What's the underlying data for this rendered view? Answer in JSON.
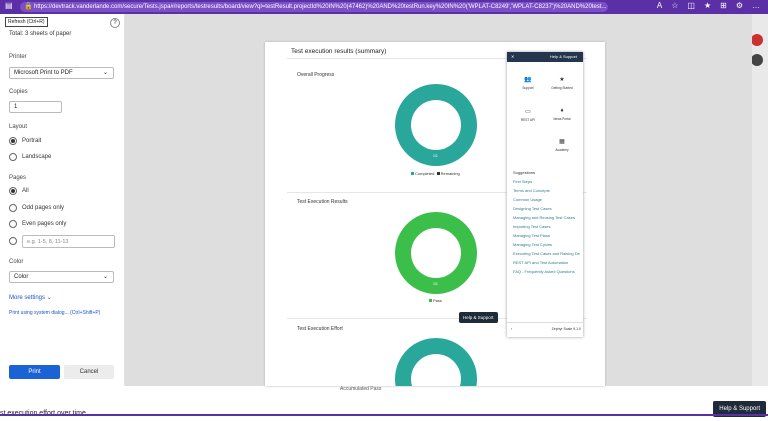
{
  "browser": {
    "url": "https://devtrack.vanderlande.com/secure/Tests.jspa#/reports/testresults/board/view?ql=testResult.projectId%20IN%20(47462)%20AND%20testRun.key%20IN%20('WPLAT-C8249','WPLAT-C8237')%20AND%20test..."
  },
  "dialog": {
    "refresh_label": "Refresh (Ctrl+R)",
    "help_icon": "?",
    "total": "Total: 3 sheets of paper",
    "printer_label": "Printer",
    "printer_value": "Microsoft Print to PDF",
    "copies_label": "Copies",
    "copies_value": "1",
    "layout_label": "Layout",
    "layout_portrait": "Portrait",
    "layout_landscape": "Landscape",
    "pages_label": "Pages",
    "pages_all": "All",
    "pages_odd": "Odd pages only",
    "pages_even": "Even pages only",
    "pages_custom_placeholder": "e.g. 1-5, 8, 11-13",
    "color_label": "Color",
    "color_value": "Color",
    "more_settings": "More settings",
    "system_dialog": "Print using system dialog... (Ctrl+Shift+P)",
    "print_button": "Print",
    "cancel_button": "Cancel"
  },
  "preview": {
    "title": "Test execution results (summary)",
    "section1": "Overall Progress",
    "section2": "Test Execution Results",
    "section3": "Test Execution Effort",
    "donut1_value": "1/1",
    "donut2_value": "1/1",
    "legend1": [
      "Completed",
      "Remaining"
    ],
    "legend2": [
      "Pass"
    ]
  },
  "help": {
    "header": "Help & Support",
    "tiles": [
      "Support",
      "Getting Started",
      "REST API",
      "Ideas Portal",
      "Academy"
    ],
    "suggestions_heading": "Suggestions",
    "suggestions": [
      "First Steps",
      "Terms and Concepts",
      "Common Usage",
      "Designing Test Cases",
      "Managing and Reusing Test Cases",
      "Importing Test Cases",
      "Managing Test Plans",
      "Managing Test Cycles",
      "Executing Test Cases and Raising De",
      "REST API and Test Automation",
      "FAQ - Frequently Asked Questions"
    ],
    "footer": "Zephyr Scale 9.1.0",
    "help_button": "Help & Support"
  },
  "background": {
    "bottom_text": "st execution effort over time",
    "bottom_legend": [
      "Accumulated",
      "Pass"
    ],
    "help_button": "Help & Support"
  },
  "colors": {
    "teal": "#2aa79b",
    "green": "#3cbf4a",
    "print_blue": "#1b63d4",
    "browser_purple": "#5b2fa6"
  }
}
